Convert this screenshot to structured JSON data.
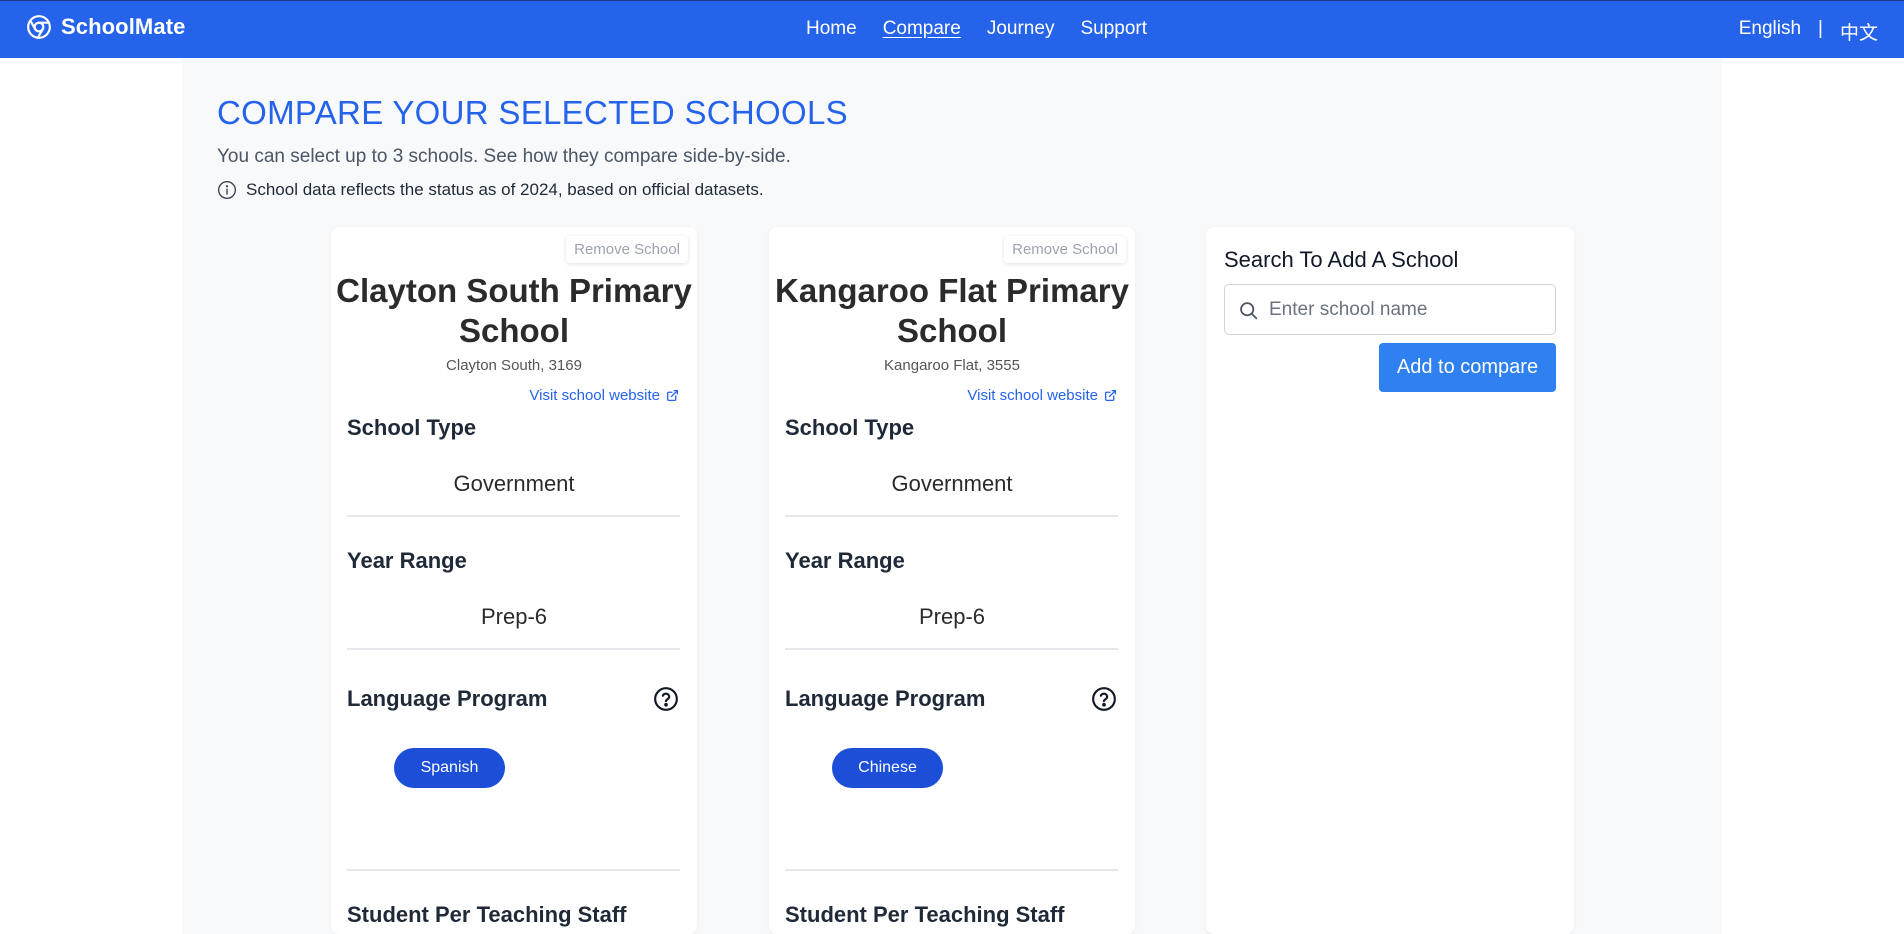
{
  "navbar": {
    "brand": "SchoolMate",
    "brand_icon": "chrome-logo-icon",
    "links": [
      {
        "label": "Home",
        "active": false
      },
      {
        "label": "Compare",
        "active": true
      },
      {
        "label": "Journey",
        "active": false
      },
      {
        "label": "Support",
        "active": false
      }
    ],
    "languages": [
      "English",
      "|",
      "中文"
    ],
    "background_color": "#2563eb"
  },
  "header": {
    "title": "COMPARE YOUR SELECTED SCHOOLS",
    "subtitle": "You can select up to 3 schools. See how they compare side-by-side.",
    "note": "School data reflects the status as of 2024, based on official datasets.",
    "note_icon": "info-icon",
    "title_color": "#2563eb"
  },
  "schools": [
    {
      "remove_label": "Remove School",
      "name": "Clayton South Primary School",
      "location": "Clayton South, 3169",
      "website_label": "Visit school website",
      "school_type_label": "School Type",
      "school_type": "Government",
      "year_range_label": "Year Range",
      "year_range": "Prep-6",
      "language_program_label": "Language Program",
      "languages": [
        "Spanish"
      ],
      "student_ratio_label": "Student Per Teaching Staff"
    },
    {
      "remove_label": "Remove School",
      "name": "Kangaroo Flat Primary School",
      "location": "Kangaroo Flat, 3555",
      "website_label": "Visit school website",
      "school_type_label": "School Type",
      "school_type": "Government",
      "year_range_label": "Year Range",
      "year_range": "Prep-6",
      "language_program_label": "Language Program",
      "languages": [
        "Chinese"
      ],
      "student_ratio_label": "Student Per Teaching Staff"
    }
  ],
  "search": {
    "title": "Search To Add A School",
    "placeholder": "Enter school name",
    "value": "",
    "button_label": "Add to compare",
    "button_color": "#2f80f0"
  },
  "colors": {
    "accent": "#2563eb",
    "pill": "#1d4ed8",
    "panel_background": "#f8f9fb"
  }
}
